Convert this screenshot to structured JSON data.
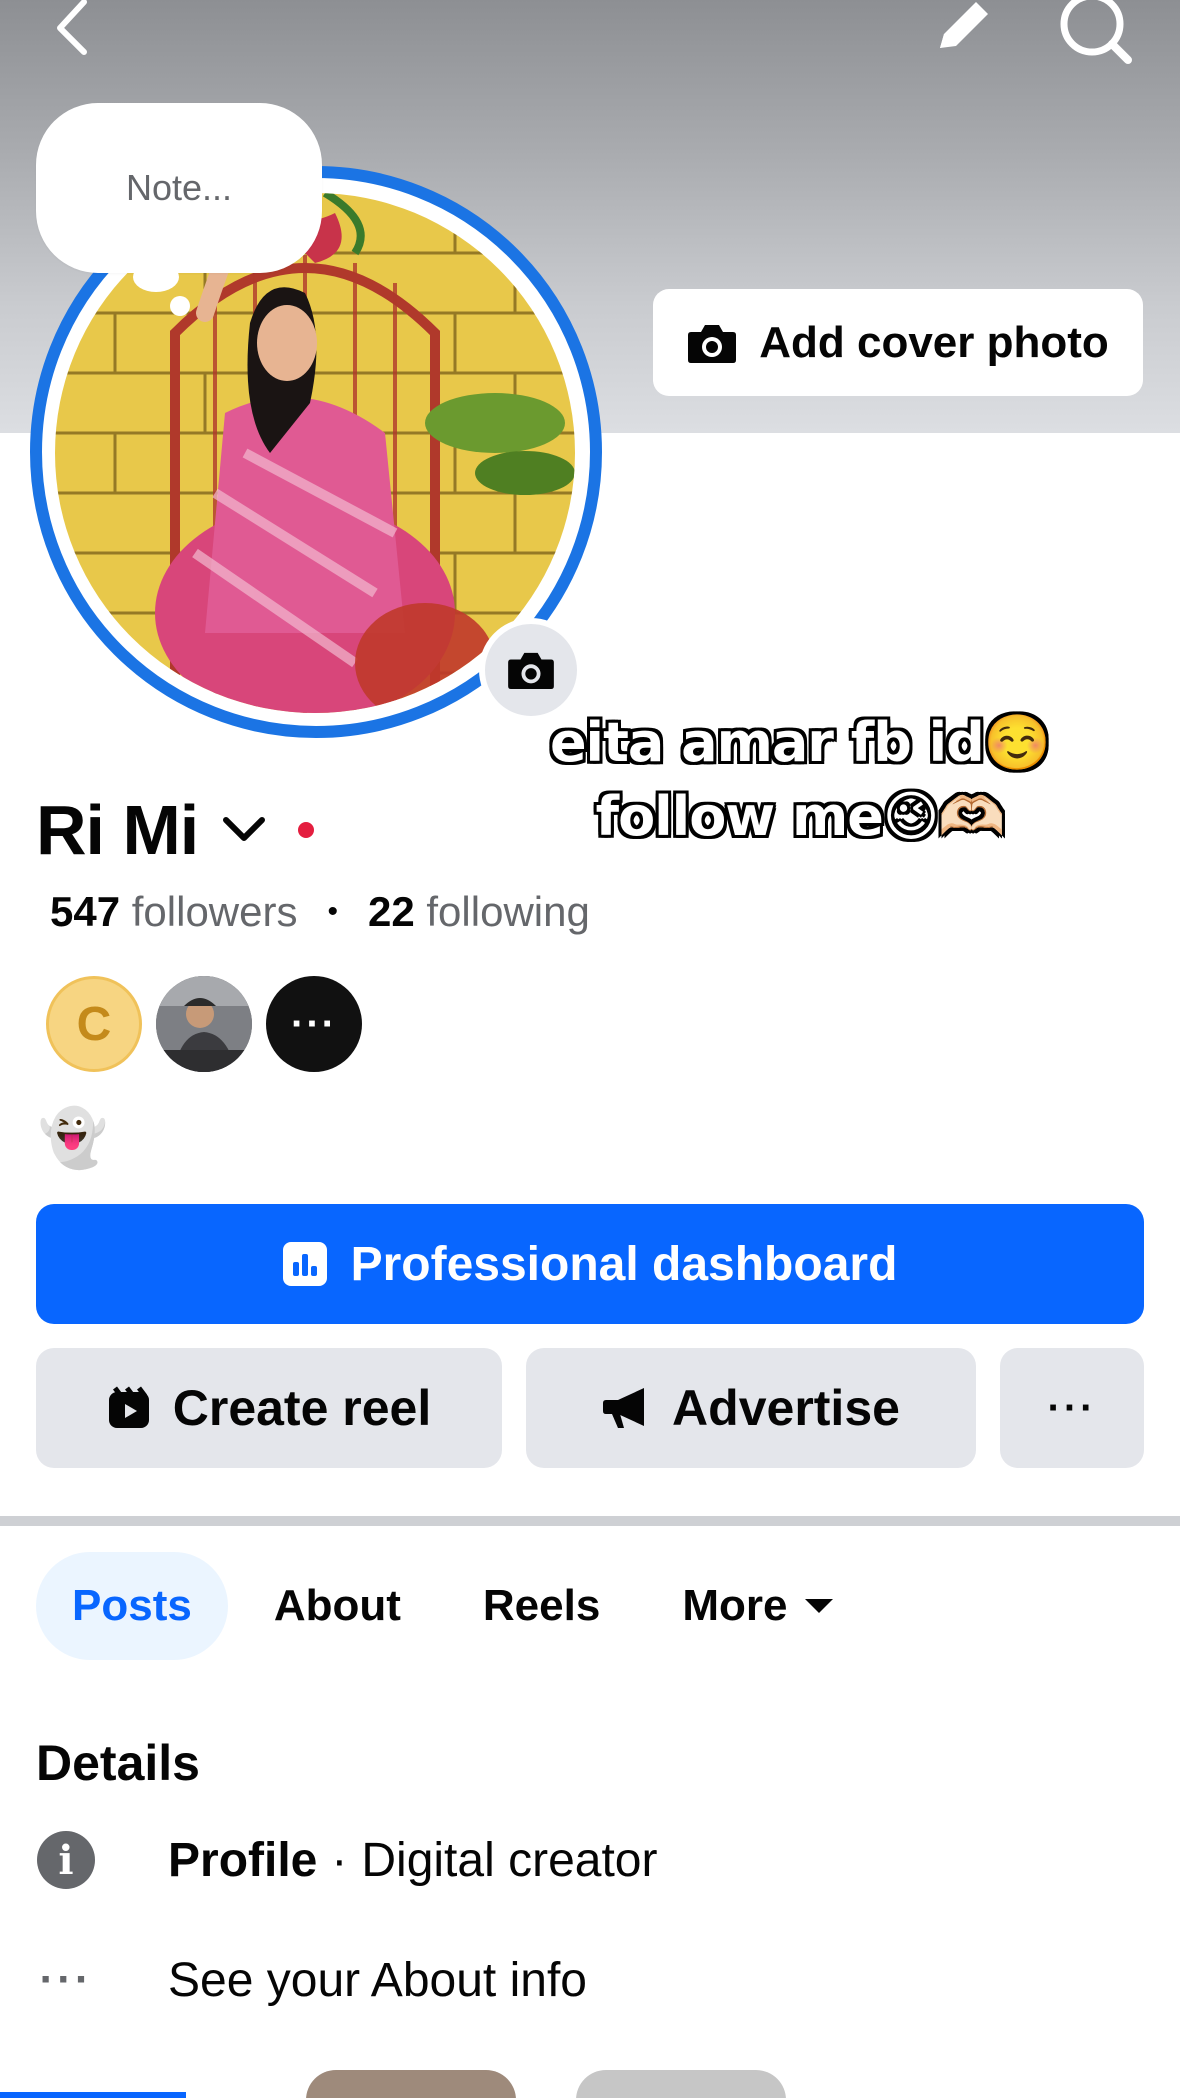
{
  "header": {
    "back_icon": "chevron-left-icon",
    "edit_icon": "pencil-icon",
    "search_icon": "search-icon"
  },
  "cover": {
    "add_cover_label": "Add cover photo",
    "add_cover_icon": "camera-icon",
    "background_color": "#a9abaf"
  },
  "note": {
    "placeholder": "Note..."
  },
  "overlay": {
    "line1": "eita amar  fb id☺️",
    "line2": "follow me😉🫶🏻"
  },
  "profile": {
    "name": "Ri Mi",
    "followers_count": "547",
    "followers_label": "followers",
    "following_count": "22",
    "following_label": "following",
    "bullet": "•",
    "bio": "👻",
    "mini_avatar_initial": "C",
    "mini_more": "···"
  },
  "actions": {
    "professional_dashboard": "Professional dashboard",
    "create_reel": "Create reel",
    "advertise": "Advertise",
    "more": "···"
  },
  "tabs": [
    {
      "label": "Posts",
      "active": true
    },
    {
      "label": "About",
      "active": false
    },
    {
      "label": "Reels",
      "active": false
    },
    {
      "label": "More",
      "active": false
    }
  ],
  "details": {
    "title": "Details",
    "profile_label": "Profile",
    "separator": "·",
    "profile_value": "Digital creator",
    "see_about": "See your About info",
    "see_about_icon": "···"
  },
  "colors": {
    "accent": "#0866ff",
    "ring": "#1b74e4",
    "secondary_button": "#e4e6eb",
    "active_tab_bg": "#ebf5ff",
    "online_dot": "#e41e3f"
  }
}
